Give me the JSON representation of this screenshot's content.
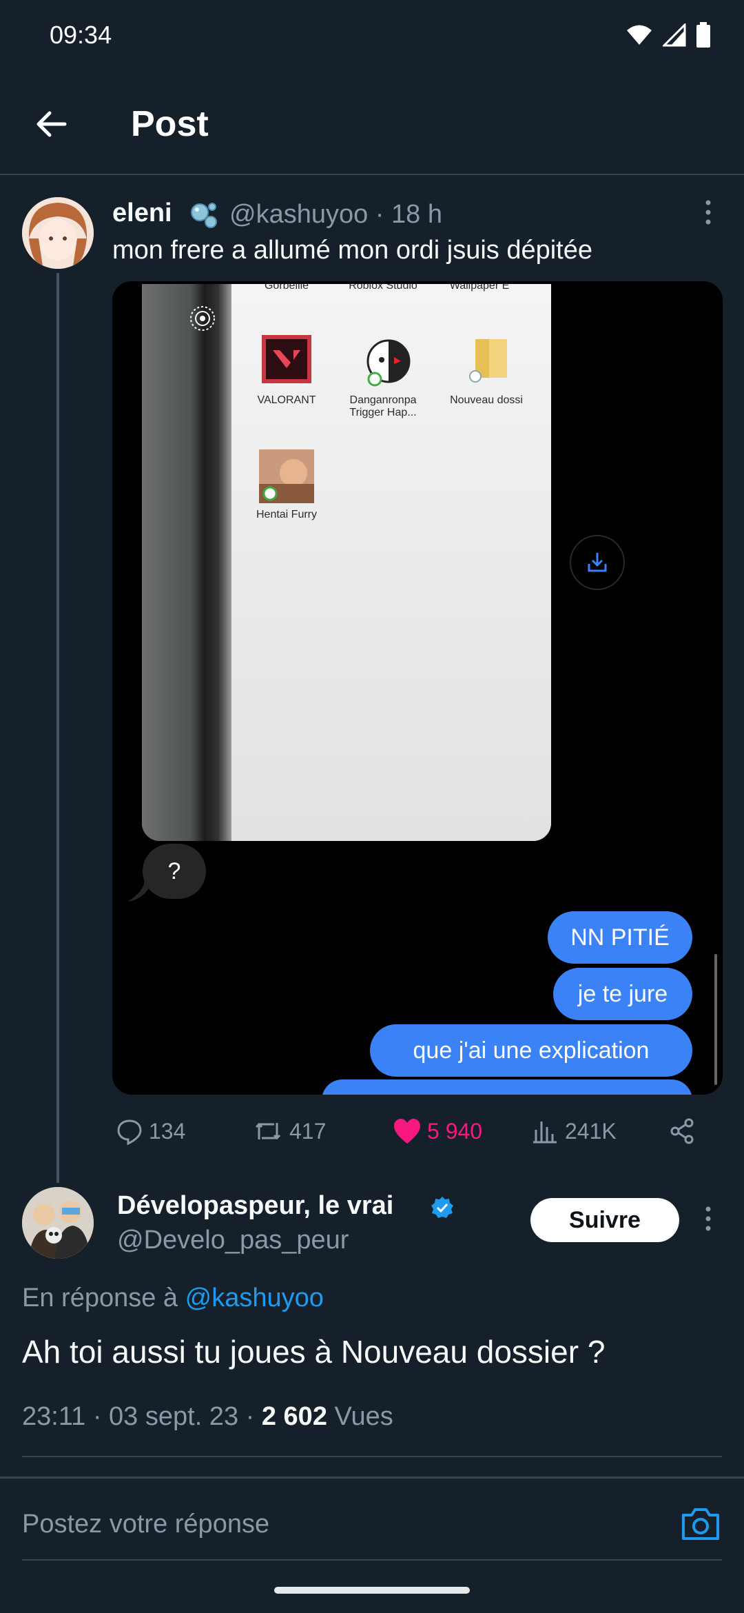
{
  "status_bar": {
    "time": "09:34"
  },
  "header": {
    "title": "Post"
  },
  "tweet": {
    "author_name": "eleni",
    "handle_time": "@kashuyoo · 18 h",
    "text": "mon frere a allumé mon ordi jsuis dépitée",
    "media": {
      "desktop_icons": [
        "Gorbeille",
        "Roblox Studio",
        "Wallpaper E",
        "VALORANT",
        "Danganronpa Trigger Hap...",
        "Nouveau dossi",
        "Hentai Furry"
      ],
      "messages": {
        "received": "?",
        "sent": [
          "NN PITIÉ",
          "je te jure",
          "que j'ai une explication"
        ]
      }
    },
    "stats": {
      "replies": "134",
      "reposts": "417",
      "likes": "5 940",
      "views": "241K"
    }
  },
  "reply": {
    "author_name": "Dévelopaspeur, le vrai",
    "handle": "@Develo_pas_peur",
    "follow_label": "Suivre",
    "reply_prefix": "En réponse à",
    "reply_mention": "@kashuyoo",
    "text": "Ah toi aussi tu joues à Nouveau dossier ?",
    "timestamp": "23:11 · 03 sept. 23 ·",
    "views_count": "2 602",
    "views_label": "Vues"
  },
  "composer": {
    "placeholder": "Postez votre réponse"
  },
  "colors": {
    "background": "#15202b",
    "like": "#f91880",
    "link": "#1d9bf0",
    "bubble_sent": "#3b82f6"
  }
}
